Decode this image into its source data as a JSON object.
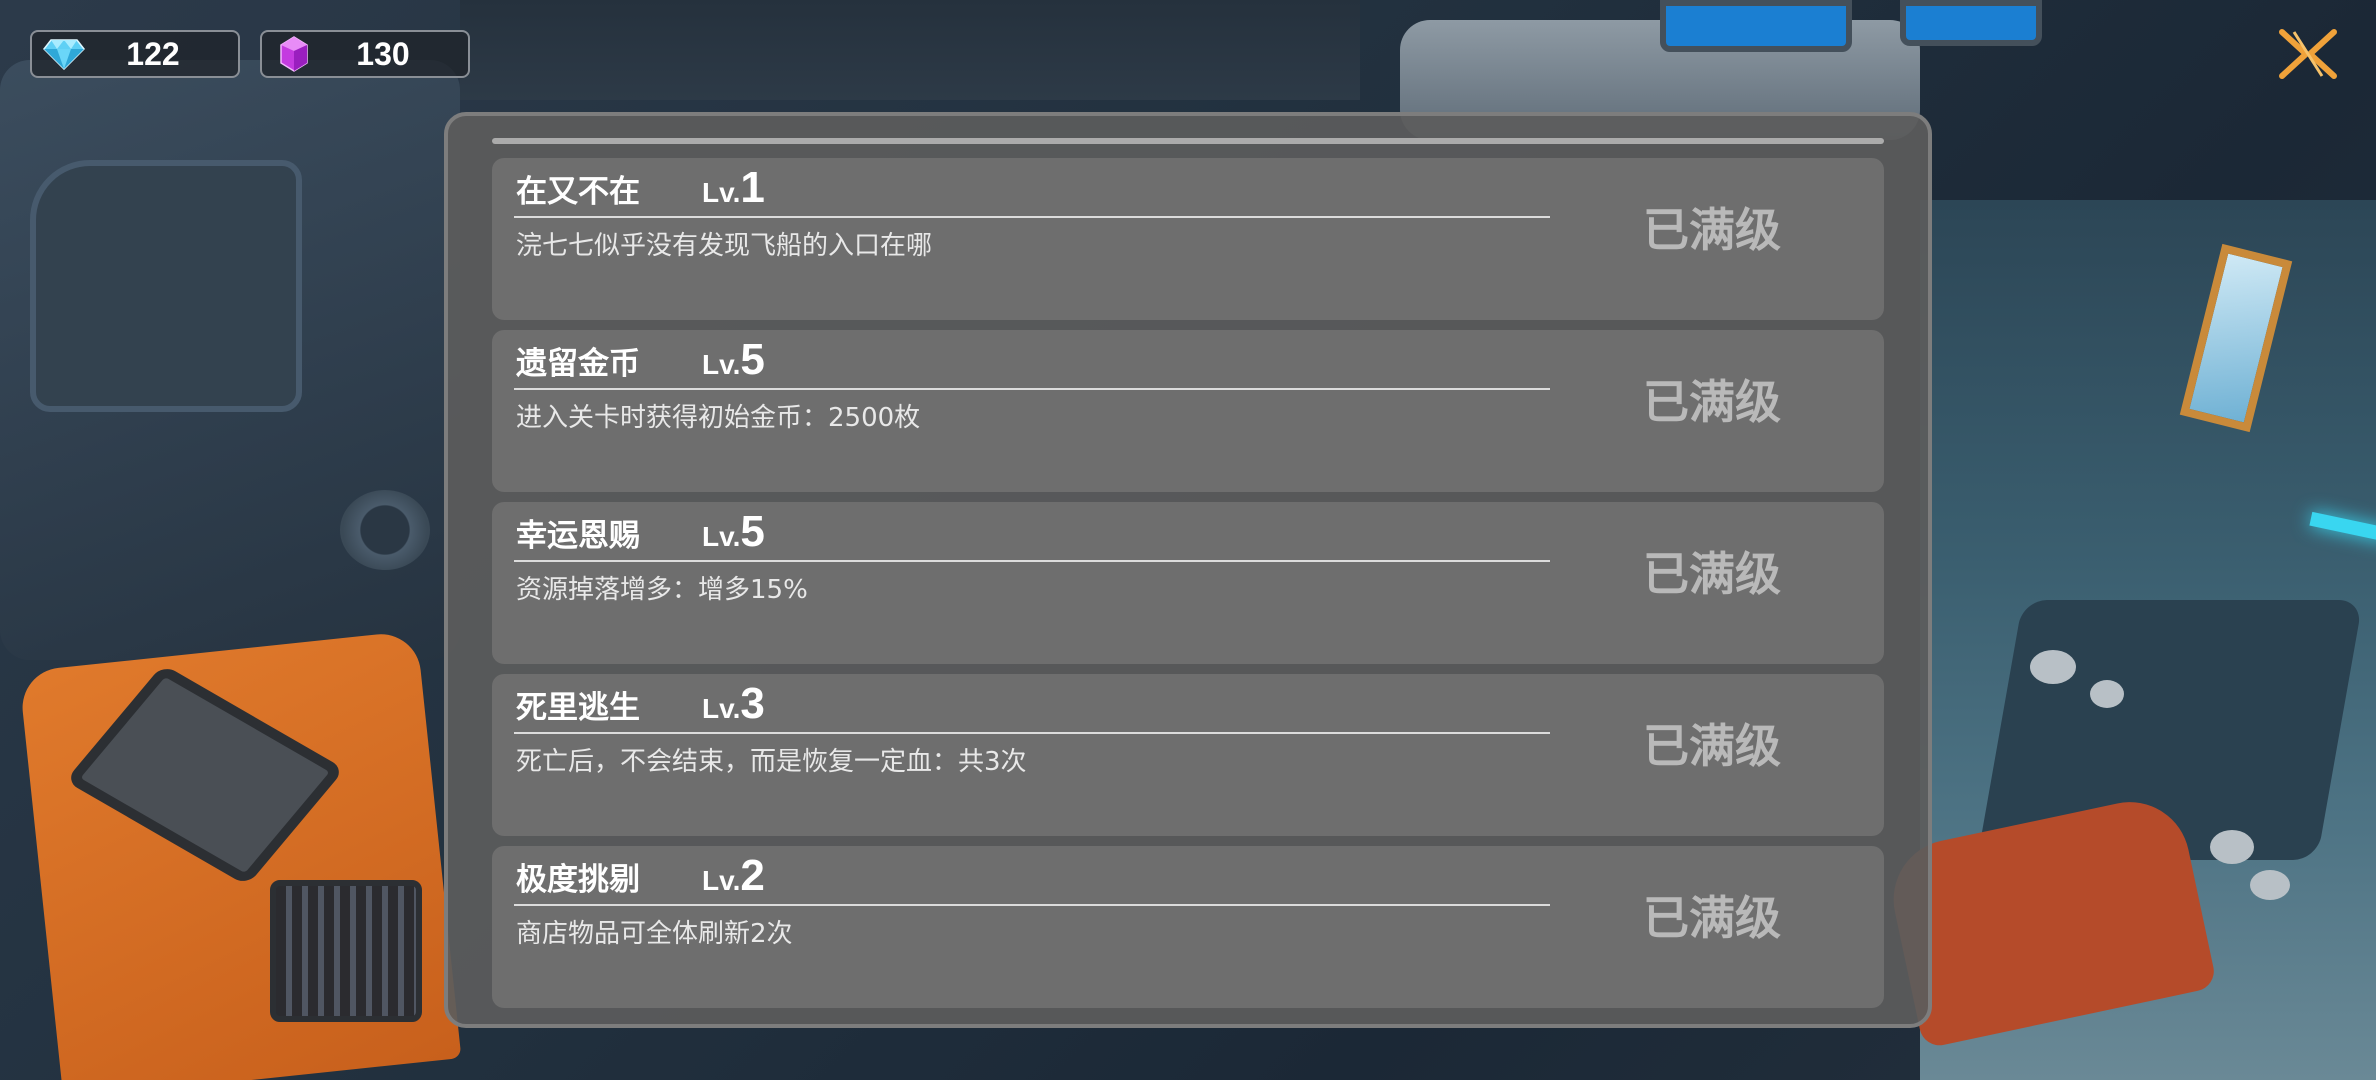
{
  "currency": {
    "gems": {
      "icon": "diamond-icon",
      "value": "122",
      "color": "#5fd0f5"
    },
    "crystals": {
      "icon": "purple-crystal-icon",
      "value": "130",
      "color": "#c43be0"
    }
  },
  "close_button": {
    "icon": "close-x-icon",
    "color": "#f0a23a"
  },
  "skills": [
    {
      "name": "在又不在",
      "lv_prefix": "Lv.",
      "level": "1",
      "description": "浣七七似乎没有发现飞船的入口在哪",
      "status": "已满级"
    },
    {
      "name": "遗留金币",
      "lv_prefix": "Lv.",
      "level": "5",
      "description": "进入关卡时获得初始金币：2500枚",
      "status": "已满级"
    },
    {
      "name": "幸运恩赐",
      "lv_prefix": "Lv.",
      "level": "5",
      "description": "资源掉落增多：增多15%",
      "status": "已满级"
    },
    {
      "name": "死里逃生",
      "lv_prefix": "Lv.",
      "level": "3",
      "description": "死亡后，不会结束，而是恢复一定血：共3次",
      "status": "已满级"
    },
    {
      "name": "极度挑剔",
      "lv_prefix": "Lv.",
      "level": "2",
      "description": "商店物品可全体刷新2次",
      "status": "已满级"
    }
  ]
}
